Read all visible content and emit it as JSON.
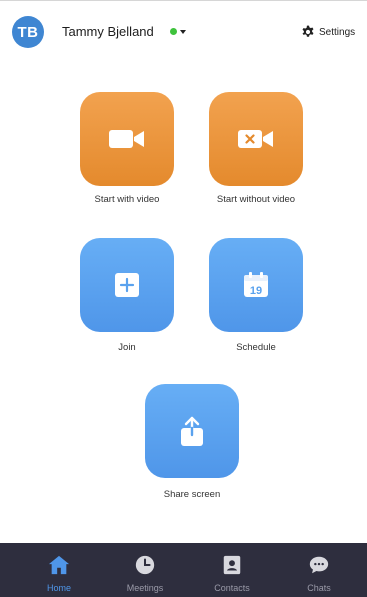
{
  "header": {
    "avatar_initials": "TB",
    "user_name": "Tammy Bjelland",
    "status_color": "#3ec23c",
    "settings_label": "Settings",
    "settings_icon": "gear-icon"
  },
  "actions": [
    {
      "label": "Start with video",
      "icon": "video-camera-icon",
      "color": "#e9922f"
    },
    {
      "label": "Start without video",
      "icon": "video-off-icon",
      "color": "#e9922f"
    },
    {
      "label": "Join",
      "icon": "plus-icon",
      "color": "#5aa2ee"
    },
    {
      "label": "Schedule",
      "icon": "calendar-icon",
      "calendar_day": "19",
      "color": "#5aa2ee"
    },
    {
      "label": "Share screen",
      "icon": "share-upload-icon",
      "color": "#5aa2ee"
    }
  ],
  "tabbar": {
    "tabs": [
      {
        "label": "Home",
        "icon": "home-icon",
        "active": true
      },
      {
        "label": "Meetings",
        "icon": "clock-icon",
        "active": false
      },
      {
        "label": "Contacts",
        "icon": "contact-card-icon",
        "active": false
      },
      {
        "label": "Chats",
        "icon": "chat-bubble-icon",
        "active": false
      }
    ],
    "active_color": "#4f96e9",
    "background": "#2e2e3e"
  }
}
